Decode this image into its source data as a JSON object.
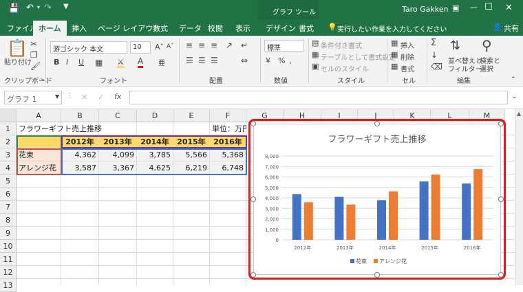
{
  "titlebar": {
    "context_tab": "グラフ ツール",
    "user": "Taro Gakken",
    "qat_icons": [
      "save-icon",
      "undo-icon",
      "redo-icon"
    ]
  },
  "tabs": [
    {
      "label": "ファイル"
    },
    {
      "label": "ホーム",
      "active": true
    },
    {
      "label": "挿入"
    },
    {
      "label": "ページ レイアウト"
    },
    {
      "label": "数式"
    },
    {
      "label": "データ"
    },
    {
      "label": "校閲"
    },
    {
      "label": "表示"
    },
    {
      "label": "デザイン"
    },
    {
      "label": "書式"
    }
  ],
  "tell_me": "実行したい作業を入力してください",
  "share": "共有",
  "ribbon": {
    "clipboard": {
      "paste": "貼り付け",
      "label": "クリップボード"
    },
    "font": {
      "name": "游ゴシック 本文",
      "size": "10",
      "label": "フォント",
      "bold": "B",
      "italic": "I",
      "underline": "U"
    },
    "alignment": {
      "label": "配置"
    },
    "number": {
      "format": "標準",
      "label": "数値"
    },
    "styles": {
      "cond": "条件付き書式",
      "table": "テーブルとして書式設定",
      "cell": "セルのスタイル",
      "label": "スタイル"
    },
    "cells": {
      "insert": "挿入",
      "delete": "削除",
      "format": "書式",
      "label": "セル"
    },
    "editing": {
      "sort": "並べ替えと\nフィルター",
      "sort1": "並べ替えと",
      "sort2": "フィルター",
      "find1": "検索と",
      "find2": "選択",
      "label": "編集"
    }
  },
  "namebox": "グラフ 1",
  "formula": {
    "fx": "fx",
    "value": ""
  },
  "columns": [
    "A",
    "B",
    "C",
    "D",
    "E",
    "F",
    "G",
    "H",
    "I",
    "J",
    "K",
    "L",
    "M"
  ],
  "rows": [
    "1",
    "2",
    "3",
    "4",
    "5",
    "6",
    "7",
    "8",
    "9",
    "10",
    "11",
    "12",
    "13"
  ],
  "sheet": {
    "title": "フラワーギフト売上推移",
    "unit": "単位：万円",
    "years": [
      "2012年",
      "2013年",
      "2014年",
      "2015年",
      "2016年"
    ],
    "row3": {
      "label": "花束",
      "values": [
        "4,362",
        "4,099",
        "3,785",
        "5,566",
        "5,368"
      ]
    },
    "row4": {
      "label": "アレンジ花",
      "values": [
        "3,587",
        "3,367",
        "4,625",
        "6,219",
        "6,748"
      ]
    }
  },
  "chart_data": {
    "type": "bar",
    "title": "フラワーギフト売上推移",
    "categories": [
      "2012年",
      "2013年",
      "2014年",
      "2015年",
      "2016年"
    ],
    "series": [
      {
        "name": "花束",
        "values": [
          4362,
          4099,
          3785,
          5566,
          5368
        ],
        "color": "#4472c4"
      },
      {
        "name": "アレンジ花",
        "values": [
          3587,
          3367,
          4625,
          6219,
          6748
        ],
        "color": "#ed7d31"
      }
    ],
    "ylim": [
      0,
      8000
    ],
    "yticks": [
      "0",
      "1,000",
      "2,000",
      "3,000",
      "4,000",
      "5,000",
      "6,000",
      "7,000",
      "8,000"
    ],
    "grid": true,
    "legend": "bottom"
  },
  "colors": {
    "accent": "#217346",
    "highlight": "#e01b1b",
    "header_fill": "#ffd966"
  }
}
